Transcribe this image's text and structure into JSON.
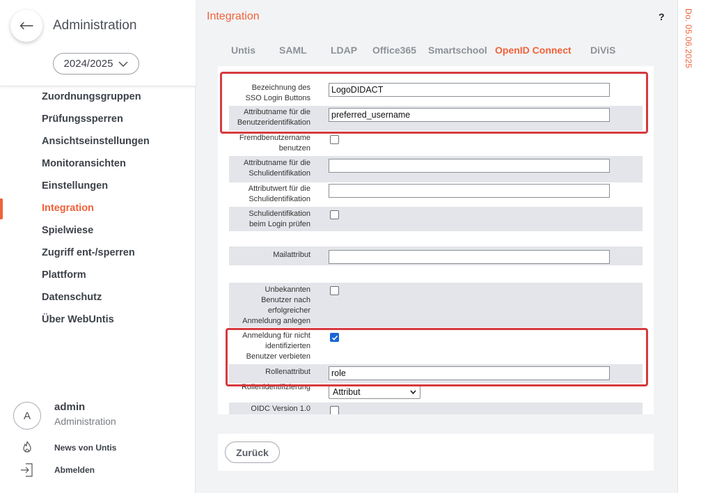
{
  "sidebar": {
    "title": "Administration",
    "year": "2024/2025",
    "nav": [
      {
        "label": "Zuordnungsgruppen",
        "active": false
      },
      {
        "label": "Prüfungssperren",
        "active": false
      },
      {
        "label": "Ansichtseinstellungen",
        "active": false
      },
      {
        "label": "Monitoransichten",
        "active": false
      },
      {
        "label": "Einstellungen",
        "active": false
      },
      {
        "label": "Integration",
        "active": true
      },
      {
        "label": "Spielwiese",
        "active": false
      },
      {
        "label": "Zugriff ent-/sperren",
        "active": false
      },
      {
        "label": "Plattform",
        "active": false
      },
      {
        "label": "Datenschutz",
        "active": false
      },
      {
        "label": "Über WebUntis",
        "active": false
      }
    ],
    "user": {
      "initial": "A",
      "name": "admin",
      "role": "Administration"
    },
    "news_label": "News von Untis",
    "logout_label": "Abmelden"
  },
  "header": {
    "title": "Integration",
    "help": "?",
    "date": "Do. 05.06.2025"
  },
  "tabs": [
    {
      "label": "Untis",
      "active": false
    },
    {
      "label": "SAML",
      "active": false
    },
    {
      "label": "LDAP",
      "active": false
    },
    {
      "label": "Office365",
      "active": false
    },
    {
      "label": "Smartschool",
      "active": false
    },
    {
      "label": "OpenID Connect",
      "active": true
    },
    {
      "label": "DiViS",
      "active": false
    }
  ],
  "form": {
    "sso_label_1": "Bezeichnung des",
    "sso_label_2": "SSO Login Buttons",
    "sso_value": "LogoDIDACT",
    "user_attr_label_1": "Attributname für die",
    "user_attr_label_2": "Benutzeridentifikation",
    "user_attr_value": "preferred_username",
    "foreign_user_label_1": "Fremdbenutzername",
    "foreign_user_label_2": "benutzen",
    "foreign_user_checked": false,
    "school_attr_label_1": "Attributname für die",
    "school_attr_label_2": "Schulidentifikation",
    "school_attr_value": "",
    "school_value_label_1": "Attributwert für die",
    "school_value_label_2": "Schulidentifikation",
    "school_value_value": "",
    "school_check_label_1": "Schulidentifikation",
    "school_check_label_2": "beim Login prüfen",
    "school_check_checked": false,
    "mail_label": "Mailattribut",
    "mail_value": "",
    "unknown_user_label_1": "Unbekannten",
    "unknown_user_label_2": "Benutzer nach",
    "unknown_user_label_3": "erfolgreicher",
    "unknown_user_label_4": "Anmeldung anlegen",
    "unknown_user_checked": false,
    "deny_login_label_1": "Anmeldung für nicht",
    "deny_login_label_2": "identifizierten",
    "deny_login_label_3": "Benutzer verbieten",
    "deny_login_checked": true,
    "role_attr_label": "Rollenattribut",
    "role_attr_value": "role",
    "role_ident_label": "Rollenidentifizierung",
    "role_ident_value": "Attribut",
    "oidc_label": "OIDC Version 1.0",
    "oidc_checked": false
  },
  "footer": {
    "back_label": "Zurück"
  },
  "colors": {
    "accent": "#f0623a",
    "highlight": "#d63a3f",
    "checkbox": "#1a66d6"
  }
}
